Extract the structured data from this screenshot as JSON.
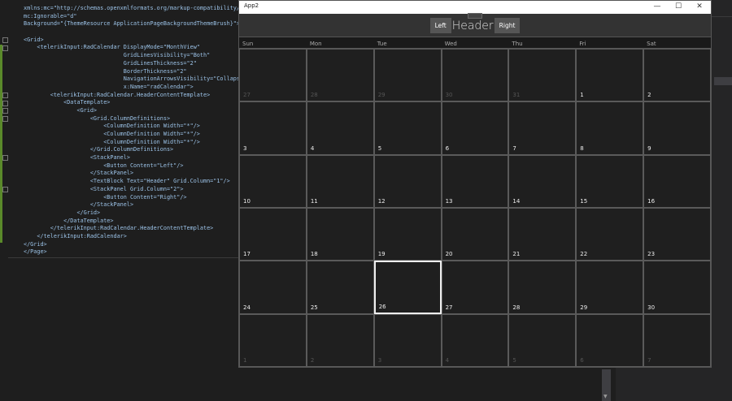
{
  "editor": {
    "lines": [
      "xmlns:mc=\"http://schemas.openxmlformats.org/markup-compatibility/",
      "mc:Ignorable=\"d\"",
      "Background=\"{ThemeResource ApplicationPageBackgroundThemeBrush}\">",
      "",
      "<Grid>",
      "    <telerikInput:RadCalendar DisplayMode=\"MonthView\"",
      "                              GridLinesVisibility=\"Both\"",
      "                              GridLinesThickness=\"2\"",
      "                              BorderThickness=\"2\"",
      "                              NavigationArrowsVisibility=\"Collapsed\"",
      "                              x:Name=\"radCalendar\">",
      "        <telerikInput:RadCalendar.HeaderContentTemplate>",
      "            <DataTemplate>",
      "                <Grid>",
      "                    <Grid.ColumnDefinitions>",
      "                        <ColumnDefinition Width=\"*\"/>",
      "                        <ColumnDefinition Width=\"*\"/>",
      "                        <ColumnDefinition Width=\"*\"/>",
      "                    </Grid.ColumnDefinitions>",
      "                    <StackPanel>",
      "                        <Button Content=\"Left\"/>",
      "                    </StackPanel>",
      "                    <TextBlock Text=\"Header\" Grid.Column=\"1\"/>",
      "                    <StackPanel Grid.Column=\"2\">",
      "                        <Button Content=\"Right\"/>",
      "                    </StackPanel>",
      "                </Grid>",
      "            </DataTemplate>",
      "        </telerikInput:RadCalendar.HeaderContentTemplate>",
      "    </telerikInput:RadCalendar>",
      "</Grid>",
      "</Page>"
    ]
  },
  "window": {
    "title": "App2",
    "minimize": "—",
    "maximize": "☐",
    "close": "✕"
  },
  "calendar": {
    "left_button": "Left",
    "header": "Header",
    "right_button": "Right",
    "day_names": [
      "Sun",
      "Mon",
      "Tue",
      "Wed",
      "Thu",
      "Fri",
      "Sat"
    ],
    "selected_day": 26,
    "days": [
      {
        "d": "27",
        "cur": false
      },
      {
        "d": "28",
        "cur": false
      },
      {
        "d": "29",
        "cur": false
      },
      {
        "d": "30",
        "cur": false
      },
      {
        "d": "31",
        "cur": false
      },
      {
        "d": "1",
        "cur": true
      },
      {
        "d": "2",
        "cur": true
      },
      {
        "d": "3",
        "cur": true
      },
      {
        "d": "4",
        "cur": true
      },
      {
        "d": "5",
        "cur": true
      },
      {
        "d": "6",
        "cur": true
      },
      {
        "d": "7",
        "cur": true
      },
      {
        "d": "8",
        "cur": true
      },
      {
        "d": "9",
        "cur": true
      },
      {
        "d": "10",
        "cur": true
      },
      {
        "d": "11",
        "cur": true
      },
      {
        "d": "12",
        "cur": true
      },
      {
        "d": "13",
        "cur": true
      },
      {
        "d": "14",
        "cur": true
      },
      {
        "d": "15",
        "cur": true
      },
      {
        "d": "16",
        "cur": true
      },
      {
        "d": "17",
        "cur": true
      },
      {
        "d": "18",
        "cur": true
      },
      {
        "d": "19",
        "cur": true
      },
      {
        "d": "20",
        "cur": true
      },
      {
        "d": "21",
        "cur": true
      },
      {
        "d": "22",
        "cur": true
      },
      {
        "d": "23",
        "cur": true
      },
      {
        "d": "24",
        "cur": true
      },
      {
        "d": "25",
        "cur": true
      },
      {
        "d": "26",
        "cur": true
      },
      {
        "d": "27",
        "cur": true
      },
      {
        "d": "28",
        "cur": true
      },
      {
        "d": "29",
        "cur": true
      },
      {
        "d": "30",
        "cur": true
      },
      {
        "d": "1",
        "cur": false
      },
      {
        "d": "2",
        "cur": false
      },
      {
        "d": "3",
        "cur": false
      },
      {
        "d": "4",
        "cur": false
      },
      {
        "d": "5",
        "cur": false
      },
      {
        "d": "6",
        "cur": false
      },
      {
        "d": "7",
        "cur": false
      }
    ]
  }
}
